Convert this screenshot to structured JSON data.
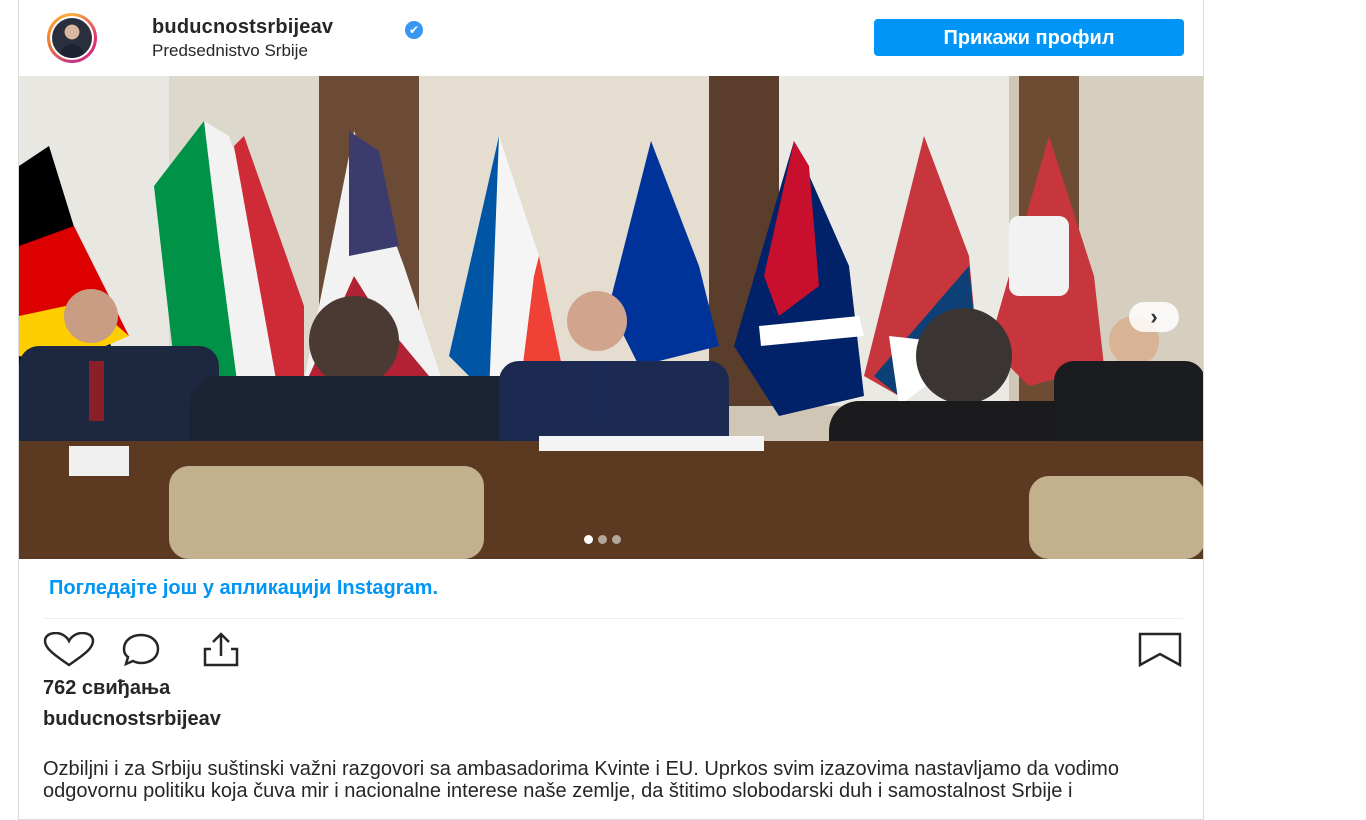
{
  "post": {
    "username": "buducnostsrbijeav",
    "location": "Predsednistvo Srbije",
    "view_profile_label": "Прикажи профил",
    "view_more_label": "Погледајте још у апликацији Instagram.",
    "likes": "762 свиђања",
    "caption_user": "buducnostsrbijeav",
    "caption_text": "Ozbiljni i za Srbiju suštinski važni razgovori sa ambasadorima Kvinte i EU. Uprkos svim izazovima nastavljamo da vodimo odgovornu politiku koja čuva mir i nacionalne interese naše zemlje, da štitimo slobodarski duh i samostalnost Srbije i",
    "carousel": {
      "count": 3,
      "active_index": 0
    }
  },
  "colors": {
    "accent": "#0095f6",
    "verified": "#3897f0",
    "text": "#262626",
    "border": "#dbdbdb"
  },
  "icons": [
    "verified-badge-icon",
    "chevron-right-icon",
    "heart-icon",
    "comment-icon",
    "share-icon",
    "bookmark-icon"
  ]
}
